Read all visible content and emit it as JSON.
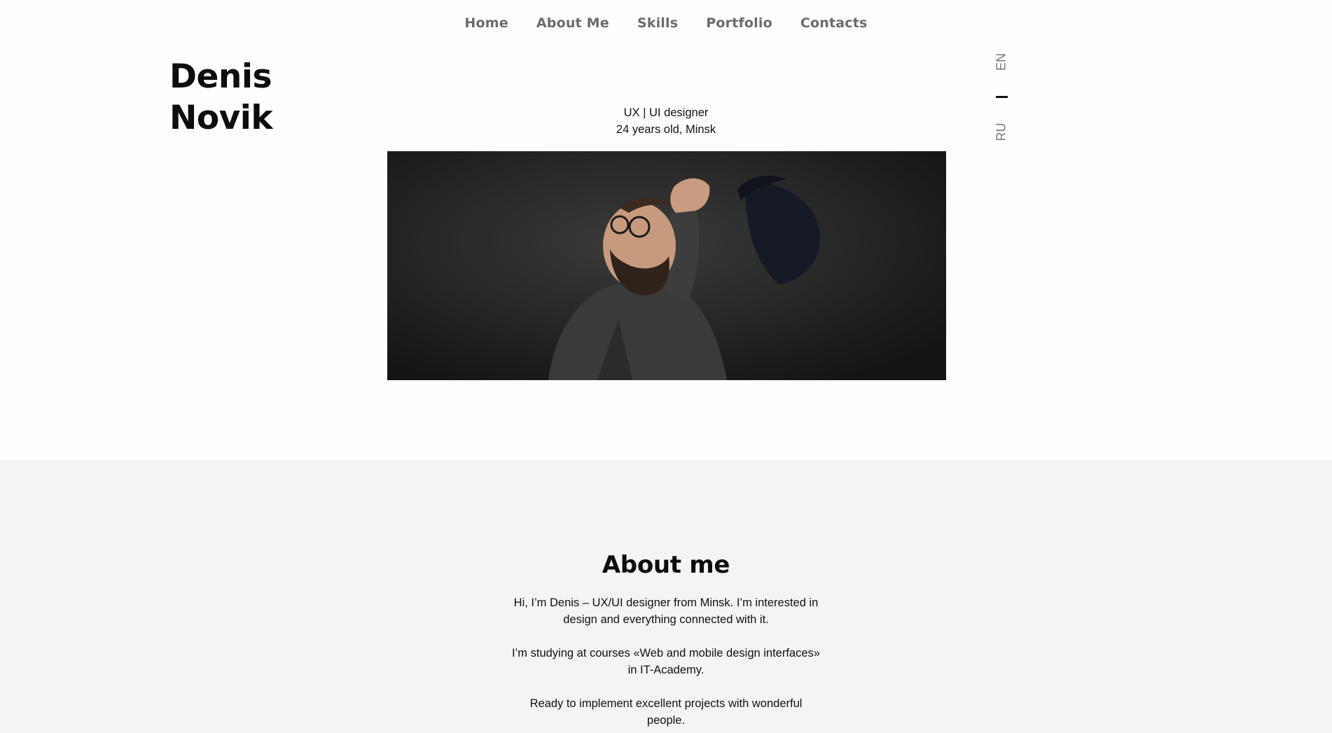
{
  "nav": {
    "items": [
      {
        "label": "Home"
      },
      {
        "label": "About Me"
      },
      {
        "label": "Skills"
      },
      {
        "label": "Portfolio"
      },
      {
        "label": "Contacts"
      }
    ]
  },
  "hero": {
    "first_name": "Denis",
    "last_name": "Novik",
    "role": "UX | UI designer",
    "meta": "24 years old, Minsk",
    "photo_icon": "portrait-photo"
  },
  "lang": {
    "en": "EN",
    "ru": "RU"
  },
  "about": {
    "title": "About me",
    "paragraphs": [
      "Hi, I’m Denis – UX/UI designer from Minsk. I’m interested in design and everything connected with it.",
      "I’m studying at courses «Web and mobile design interfaces» in IT-Academy.",
      "Ready to implement excellent projects with wonderful people."
    ]
  },
  "colors": {
    "nav_text": "#6b6b6b",
    "heading": "#0d0d0d",
    "about_bg": "#f4f4f4"
  }
}
